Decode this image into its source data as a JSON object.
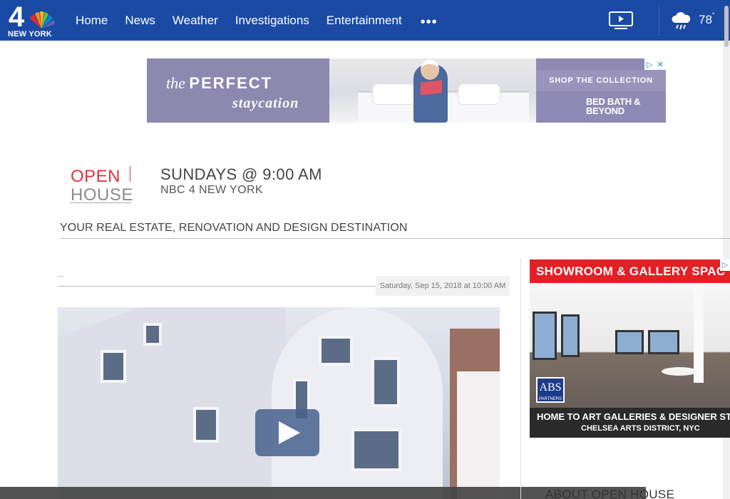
{
  "brand": {
    "logo_number": "4",
    "logo_text": "NEW YORK"
  },
  "nav": {
    "items": [
      {
        "label": "Home"
      },
      {
        "label": "News"
      },
      {
        "label": "Weather"
      },
      {
        "label": "Investigations"
      },
      {
        "label": "Entertainment"
      }
    ],
    "more_label": "•••",
    "temperature": "78",
    "temperature_unit": "°"
  },
  "top_ad": {
    "line1_prefix": "the",
    "line1_bold": "PERFECT",
    "line2": "staycation",
    "cta": "SHOP THE COLLECTION",
    "brand_line1": "BED BATH &",
    "brand_line2": "BEYOND"
  },
  "show": {
    "logo_open": "OPEN",
    "logo_house": "HOUSE",
    "schedule": "SUNDAYS @ 9:00 AM",
    "station": "NBC 4 NEW YORK",
    "tagline": "YOUR REAL ESTATE, RENOVATION AND DESIGN DESTINATION"
  },
  "article": {
    "timestamp": "Saturday, Sep 15, 2018 at 10:00 AM"
  },
  "side_ad": {
    "headline": "SHOWROOM & GALLERY SPAC",
    "logo": "ABS",
    "logo_sub": "PARTNERS",
    "caption1": "HOME TO ART GALLERIES & DESIGNER STUDIO",
    "caption2": "CHELSEA ARTS DISTRICT, NYC"
  },
  "sidebar": {
    "about_heading": "ABOUT OPEN HOUSE"
  },
  "colors": {
    "nav_bg": "#1a4aa3",
    "accent_red": "#e0323f",
    "ad_purple": "#8f8ab3",
    "side_ad_red": "#e32026"
  }
}
